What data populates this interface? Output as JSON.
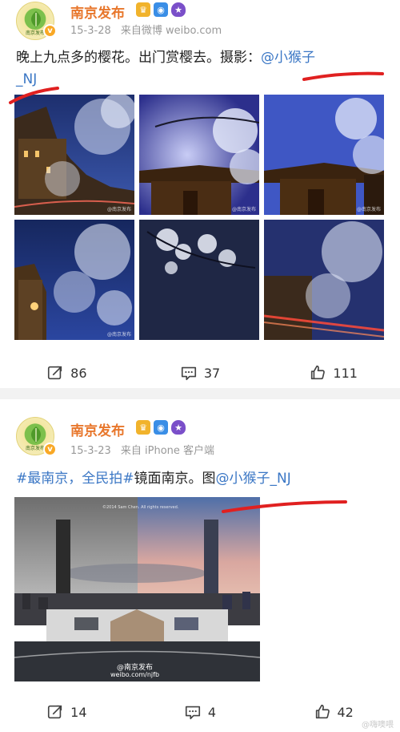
{
  "posts": [
    {
      "user": {
        "name": "南京发布",
        "verified_mark": "v",
        "avatar_text": "南京发布"
      },
      "meta": {
        "date": "15-3-28",
        "source": "来自微博 weibo.com"
      },
      "text": {
        "body": "晚上九点多的樱花。出门赏樱去。摄影：",
        "mention_line1": "@小猴子",
        "mention_line2": "_NJ"
      },
      "image_watermark": "@南京发布",
      "actions": {
        "reposts": "86",
        "comments": "37",
        "likes": "111"
      }
    },
    {
      "user": {
        "name": "南京发布",
        "verified_mark": "v",
        "avatar_text": "南京发布"
      },
      "meta": {
        "date": "15-3-23",
        "source": "来自 iPhone 客户端"
      },
      "text": {
        "topic": "#最南京，全民拍#",
        "body": "镜面南京。图",
        "mention": "@小猴子_NJ"
      },
      "image_watermark_top": "©2014 Sam Chen. All rights reserved.",
      "image_watermark_bottom": "@南京发布",
      "image_watermark_url": "weibo.com/njfb",
      "actions": {
        "reposts": "14",
        "comments": "4",
        "likes": "42"
      }
    }
  ],
  "footer_watermark": "@嗨噢喂",
  "colors": {
    "username": "#e8772c",
    "link": "#3b77c5",
    "annotation": "#e02020"
  },
  "icons": [
    "repost-icon",
    "comment-icon",
    "like-icon",
    "crown-icon",
    "camera-icon",
    "shield-icon"
  ]
}
